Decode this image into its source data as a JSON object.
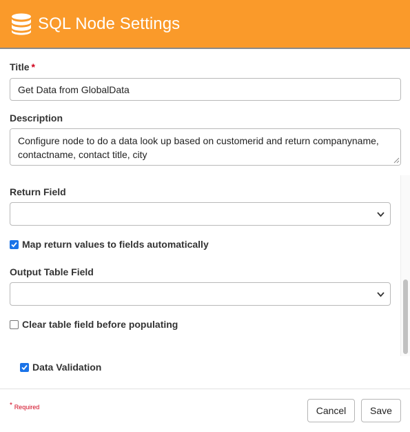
{
  "header": {
    "title": "SQL Node Settings",
    "icon": "database-icon",
    "background": "#fa9a2a"
  },
  "form": {
    "title_label": "Title",
    "required_marker": "*",
    "title_value": "Get Data from GlobalData",
    "description_label": "Description",
    "description_value": "Configure node to do a data look up based on customerid and return companyname, contactname, contact title, city",
    "return_field_label": "Return Field",
    "return_field_value": "",
    "map_return_label": "Map return values to fields automatically",
    "map_return_checked": true,
    "output_table_label": "Output Table Field",
    "output_table_value": "",
    "clear_table_label": "Clear table field before populating",
    "clear_table_checked": false,
    "data_validation_label": "Data Validation",
    "data_validation_checked": true
  },
  "footer": {
    "required_star": "*",
    "required_note": "Required",
    "cancel_label": "Cancel",
    "save_label": "Save"
  },
  "colors": {
    "accent": "#fa9a2a",
    "required": "#d0021b",
    "checkbox": "#1a73e8"
  }
}
